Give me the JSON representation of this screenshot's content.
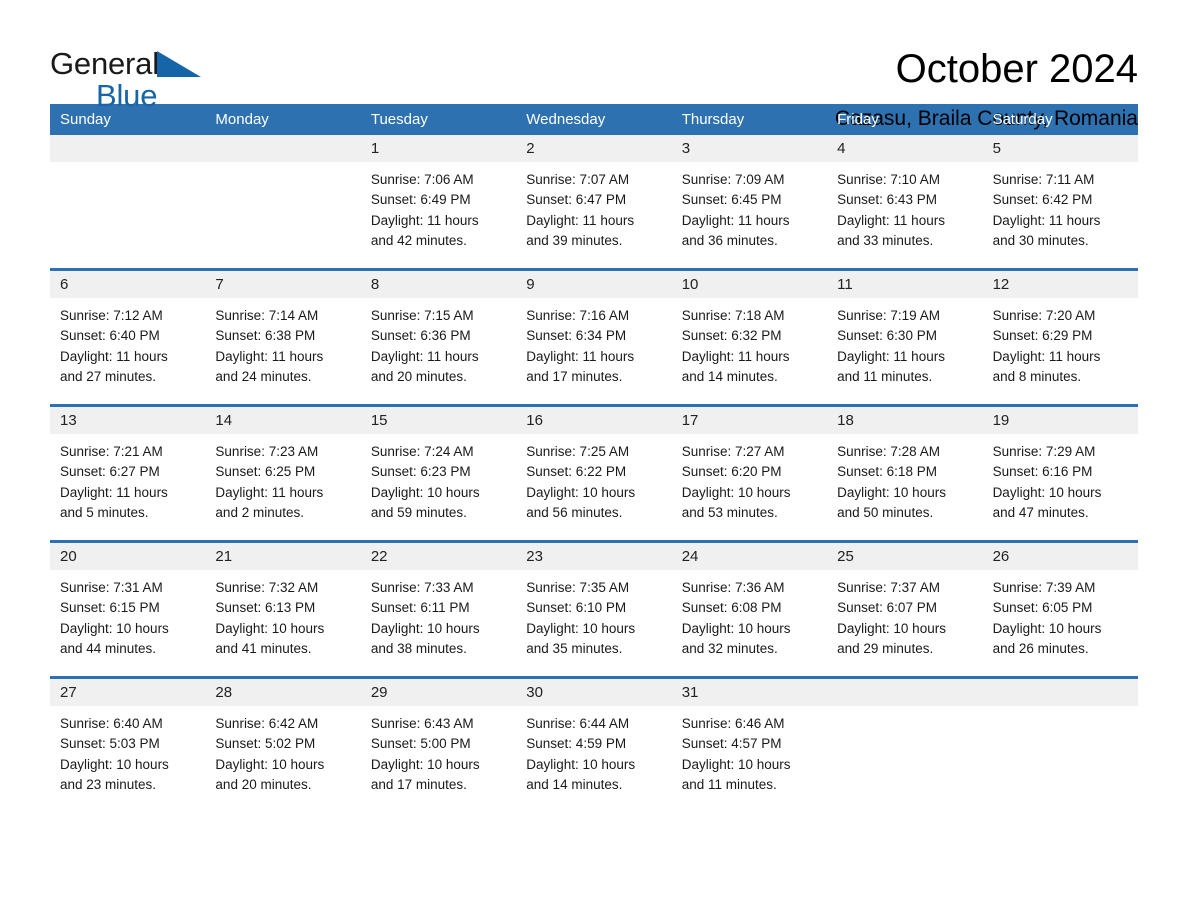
{
  "brand": {
    "name_part1": "General",
    "name_part2": "Blue",
    "accent_color": "#1565a8",
    "triangle_icon": "triangle-logo-icon"
  },
  "header": {
    "title": "October 2024",
    "subtitle": "Cazasu, Braila County, Romania"
  },
  "calendar": {
    "header_bg": "#2d71b0",
    "weekdays": [
      "Sunday",
      "Monday",
      "Tuesday",
      "Wednesday",
      "Thursday",
      "Friday",
      "Saturday"
    ],
    "weeks": [
      [
        {
          "day": "",
          "sunrise": "",
          "sunset": "",
          "daylight_line1": "",
          "daylight_line2": ""
        },
        {
          "day": "",
          "sunrise": "",
          "sunset": "",
          "daylight_line1": "",
          "daylight_line2": ""
        },
        {
          "day": "1",
          "sunrise": "Sunrise: 7:06 AM",
          "sunset": "Sunset: 6:49 PM",
          "daylight_line1": "Daylight: 11 hours",
          "daylight_line2": "and 42 minutes."
        },
        {
          "day": "2",
          "sunrise": "Sunrise: 7:07 AM",
          "sunset": "Sunset: 6:47 PM",
          "daylight_line1": "Daylight: 11 hours",
          "daylight_line2": "and 39 minutes."
        },
        {
          "day": "3",
          "sunrise": "Sunrise: 7:09 AM",
          "sunset": "Sunset: 6:45 PM",
          "daylight_line1": "Daylight: 11 hours",
          "daylight_line2": "and 36 minutes."
        },
        {
          "day": "4",
          "sunrise": "Sunrise: 7:10 AM",
          "sunset": "Sunset: 6:43 PM",
          "daylight_line1": "Daylight: 11 hours",
          "daylight_line2": "and 33 minutes."
        },
        {
          "day": "5",
          "sunrise": "Sunrise: 7:11 AM",
          "sunset": "Sunset: 6:42 PM",
          "daylight_line1": "Daylight: 11 hours",
          "daylight_line2": "and 30 minutes."
        }
      ],
      [
        {
          "day": "6",
          "sunrise": "Sunrise: 7:12 AM",
          "sunset": "Sunset: 6:40 PM",
          "daylight_line1": "Daylight: 11 hours",
          "daylight_line2": "and 27 minutes."
        },
        {
          "day": "7",
          "sunrise": "Sunrise: 7:14 AM",
          "sunset": "Sunset: 6:38 PM",
          "daylight_line1": "Daylight: 11 hours",
          "daylight_line2": "and 24 minutes."
        },
        {
          "day": "8",
          "sunrise": "Sunrise: 7:15 AM",
          "sunset": "Sunset: 6:36 PM",
          "daylight_line1": "Daylight: 11 hours",
          "daylight_line2": "and 20 minutes."
        },
        {
          "day": "9",
          "sunrise": "Sunrise: 7:16 AM",
          "sunset": "Sunset: 6:34 PM",
          "daylight_line1": "Daylight: 11 hours",
          "daylight_line2": "and 17 minutes."
        },
        {
          "day": "10",
          "sunrise": "Sunrise: 7:18 AM",
          "sunset": "Sunset: 6:32 PM",
          "daylight_line1": "Daylight: 11 hours",
          "daylight_line2": "and 14 minutes."
        },
        {
          "day": "11",
          "sunrise": "Sunrise: 7:19 AM",
          "sunset": "Sunset: 6:30 PM",
          "daylight_line1": "Daylight: 11 hours",
          "daylight_line2": "and 11 minutes."
        },
        {
          "day": "12",
          "sunrise": "Sunrise: 7:20 AM",
          "sunset": "Sunset: 6:29 PM",
          "daylight_line1": "Daylight: 11 hours",
          "daylight_line2": "and 8 minutes."
        }
      ],
      [
        {
          "day": "13",
          "sunrise": "Sunrise: 7:21 AM",
          "sunset": "Sunset: 6:27 PM",
          "daylight_line1": "Daylight: 11 hours",
          "daylight_line2": "and 5 minutes."
        },
        {
          "day": "14",
          "sunrise": "Sunrise: 7:23 AM",
          "sunset": "Sunset: 6:25 PM",
          "daylight_line1": "Daylight: 11 hours",
          "daylight_line2": "and 2 minutes."
        },
        {
          "day": "15",
          "sunrise": "Sunrise: 7:24 AM",
          "sunset": "Sunset: 6:23 PM",
          "daylight_line1": "Daylight: 10 hours",
          "daylight_line2": "and 59 minutes."
        },
        {
          "day": "16",
          "sunrise": "Sunrise: 7:25 AM",
          "sunset": "Sunset: 6:22 PM",
          "daylight_line1": "Daylight: 10 hours",
          "daylight_line2": "and 56 minutes."
        },
        {
          "day": "17",
          "sunrise": "Sunrise: 7:27 AM",
          "sunset": "Sunset: 6:20 PM",
          "daylight_line1": "Daylight: 10 hours",
          "daylight_line2": "and 53 minutes."
        },
        {
          "day": "18",
          "sunrise": "Sunrise: 7:28 AM",
          "sunset": "Sunset: 6:18 PM",
          "daylight_line1": "Daylight: 10 hours",
          "daylight_line2": "and 50 minutes."
        },
        {
          "day": "19",
          "sunrise": "Sunrise: 7:29 AM",
          "sunset": "Sunset: 6:16 PM",
          "daylight_line1": "Daylight: 10 hours",
          "daylight_line2": "and 47 minutes."
        }
      ],
      [
        {
          "day": "20",
          "sunrise": "Sunrise: 7:31 AM",
          "sunset": "Sunset: 6:15 PM",
          "daylight_line1": "Daylight: 10 hours",
          "daylight_line2": "and 44 minutes."
        },
        {
          "day": "21",
          "sunrise": "Sunrise: 7:32 AM",
          "sunset": "Sunset: 6:13 PM",
          "daylight_line1": "Daylight: 10 hours",
          "daylight_line2": "and 41 minutes."
        },
        {
          "day": "22",
          "sunrise": "Sunrise: 7:33 AM",
          "sunset": "Sunset: 6:11 PM",
          "daylight_line1": "Daylight: 10 hours",
          "daylight_line2": "and 38 minutes."
        },
        {
          "day": "23",
          "sunrise": "Sunrise: 7:35 AM",
          "sunset": "Sunset: 6:10 PM",
          "daylight_line1": "Daylight: 10 hours",
          "daylight_line2": "and 35 minutes."
        },
        {
          "day": "24",
          "sunrise": "Sunrise: 7:36 AM",
          "sunset": "Sunset: 6:08 PM",
          "daylight_line1": "Daylight: 10 hours",
          "daylight_line2": "and 32 minutes."
        },
        {
          "day": "25",
          "sunrise": "Sunrise: 7:37 AM",
          "sunset": "Sunset: 6:07 PM",
          "daylight_line1": "Daylight: 10 hours",
          "daylight_line2": "and 29 minutes."
        },
        {
          "day": "26",
          "sunrise": "Sunrise: 7:39 AM",
          "sunset": "Sunset: 6:05 PM",
          "daylight_line1": "Daylight: 10 hours",
          "daylight_line2": "and 26 minutes."
        }
      ],
      [
        {
          "day": "27",
          "sunrise": "Sunrise: 6:40 AM",
          "sunset": "Sunset: 5:03 PM",
          "daylight_line1": "Daylight: 10 hours",
          "daylight_line2": "and 23 minutes."
        },
        {
          "day": "28",
          "sunrise": "Sunrise: 6:42 AM",
          "sunset": "Sunset: 5:02 PM",
          "daylight_line1": "Daylight: 10 hours",
          "daylight_line2": "and 20 minutes."
        },
        {
          "day": "29",
          "sunrise": "Sunrise: 6:43 AM",
          "sunset": "Sunset: 5:00 PM",
          "daylight_line1": "Daylight: 10 hours",
          "daylight_line2": "and 17 minutes."
        },
        {
          "day": "30",
          "sunrise": "Sunrise: 6:44 AM",
          "sunset": "Sunset: 4:59 PM",
          "daylight_line1": "Daylight: 10 hours",
          "daylight_line2": "and 14 minutes."
        },
        {
          "day": "31",
          "sunrise": "Sunrise: 6:46 AM",
          "sunset": "Sunset: 4:57 PM",
          "daylight_line1": "Daylight: 10 hours",
          "daylight_line2": "and 11 minutes."
        },
        {
          "day": "",
          "sunrise": "",
          "sunset": "",
          "daylight_line1": "",
          "daylight_line2": ""
        },
        {
          "day": "",
          "sunrise": "",
          "sunset": "",
          "daylight_line1": "",
          "daylight_line2": ""
        }
      ]
    ]
  }
}
